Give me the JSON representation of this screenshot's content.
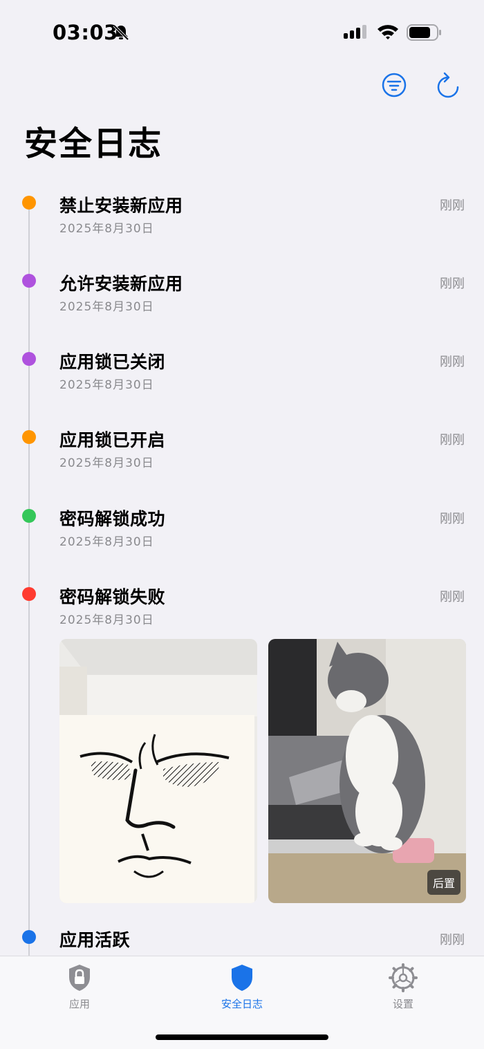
{
  "status_bar": {
    "time": "03:03",
    "icons": [
      "bell-slash-icon",
      "signal-icon",
      "wifi-icon",
      "battery-icon"
    ]
  },
  "header": {
    "title": "安全日志",
    "actions": [
      "filter-icon",
      "refresh-icon"
    ]
  },
  "accent_color": "#1a73e8",
  "logs": [
    {
      "title": "禁止安装新应用",
      "date": "2025年8月30日",
      "time": "刚刚",
      "color": "#ff9500"
    },
    {
      "title": "允许安装新应用",
      "date": "2025年8月30日",
      "time": "刚刚",
      "color": "#af52de"
    },
    {
      "title": "应用锁已关闭",
      "date": "2025年8月30日",
      "time": "刚刚",
      "color": "#af52de"
    },
    {
      "title": "应用锁已开启",
      "date": "2025年8月30日",
      "time": "刚刚",
      "color": "#ff9500"
    },
    {
      "title": "密码解锁成功",
      "date": "2025年8月30日",
      "time": "刚刚",
      "color": "#34c759"
    },
    {
      "title": "密码解锁失败",
      "date": "2025年8月30日",
      "time": "刚刚",
      "color": "#ff3b30"
    },
    {
      "title": "应用活跃",
      "date": "",
      "time": "刚刚",
      "color": "#1a73e8"
    }
  ],
  "photos": {
    "front": {
      "icon": "face-sketch-photo"
    },
    "rear": {
      "badge": "后置",
      "icon": "cat-photo"
    }
  },
  "tab_bar": {
    "tabs": [
      {
        "label": "应用",
        "icon": "lock-shield-icon",
        "active": false
      },
      {
        "label": "安全日志",
        "icon": "shield-icon",
        "active": true
      },
      {
        "label": "设置",
        "icon": "gear-icon",
        "active": false
      }
    ]
  }
}
